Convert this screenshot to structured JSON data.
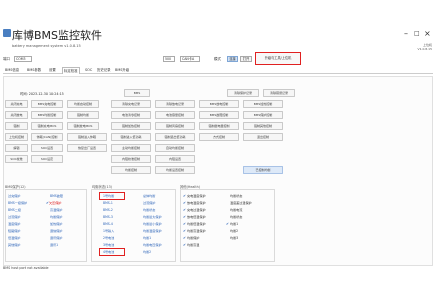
{
  "window": {
    "title": "库博BMS监控软件",
    "subtitle": "battery management system v1.0.8.15",
    "right_version": [
      "上位机",
      "V1.0.8.15"
    ]
  },
  "connection": {
    "port_label": "端口",
    "port_value": "COM3",
    "rate_value": "500",
    "can_value": "CAN卡A",
    "mode_label": "模式",
    "connect_btn": "连接",
    "open_btn": "打开",
    "tool_btn": "升级与工具/上位机"
  },
  "tabs": [
    "BMS信息",
    "BMS参数",
    "设置",
    "标定校准",
    "SOC",
    "历史记录",
    "BMS升级"
  ],
  "panel": {
    "time_label": "时间: 2023-12-30 10:24:15",
    "buttons": [
      [
        "BMS",
        "清除保护记录",
        "清除错误记录"
      ],
      [
        "关闭充电",
        "BMS充电控制",
        "均衡启动控制",
        "清除充电记录",
        "清除放电记录",
        "BMS放电控制",
        "BMS加热控制"
      ],
      [
        "关闭放电",
        "BMS均衡控制",
        "强制均衡",
        "电池清零控制",
        "电池容量控制",
        "BMS故障控制",
        "BMS保护控制"
      ],
      [
        "强制",
        "强制充电MOS",
        "强制放电MOS",
        "强制加热控制",
        "强制风扇控制",
        "强制继电器控制",
        "强制其他控制"
      ],
      [
        "上位机控制",
        "休眠(CAN)控制",
        "强制进入休眠",
        "强制进入低功耗",
        "强制退出低功耗",
        "方式控制",
        "退出控制"
      ],
      [
        "解锁",
        "SOC设置",
        "恢复出厂设置",
        "主动均衡控制",
        "自动均衡控制"
      ],
      [
        "SOC校准",
        "SOC设定",
        "内阻校准控制",
        "内阻设置"
      ],
      [
        "均衡控制",
        "均衡设置控制",
        "已控制均衡"
      ]
    ]
  },
  "groups": {
    "left": {
      "title": "BMS保护(12)",
      "col1": [
        "过充保护",
        "BMS一级保护",
        "BMS二级",
        "过流保护",
        "温度保护",
        "短路保护",
        "低温保护",
        "其他保护"
      ],
      "col2": [
        "BMS故障",
        "欠压保护",
        "高温保护",
        "均衡保护",
        "加热保护",
        "通信保护",
        "通讯保护",
        "通讯1"
      ]
    },
    "middle": {
      "title": "均衡状态(13)",
      "col1": [
        "1号均衡",
        "BMS-1",
        "BMS-2",
        "BMS-3",
        "BMS-4",
        "1号输入",
        "2号电池",
        "3号电池",
        "4号电池",
        "均衡状态"
      ],
      "col2": [
        "总体均衡",
        "过流保护",
        "均衡状态",
        "均衡最大保护",
        "均衡最小保护",
        "均衡温度保护",
        "均衡1",
        "均衡电压保护",
        "均衡2"
      ]
    },
    "right": {
      "title": "其他(Health)",
      "col1": [
        "充电温度保护",
        "放电温度保护",
        "充电过温保护",
        "放电低温保护",
        "均衡低温保护",
        "均衡高温保护",
        "均衡保护",
        "均衡高温"
      ],
      "col2": [
        "均衡状态",
        "温度差过温保护",
        "均衡电流",
        "均衡状态",
        "均衡1",
        "均衡2",
        "均衡3"
      ]
    }
  },
  "right_btn": "已控制均衡",
  "status": "BMS host port not available"
}
